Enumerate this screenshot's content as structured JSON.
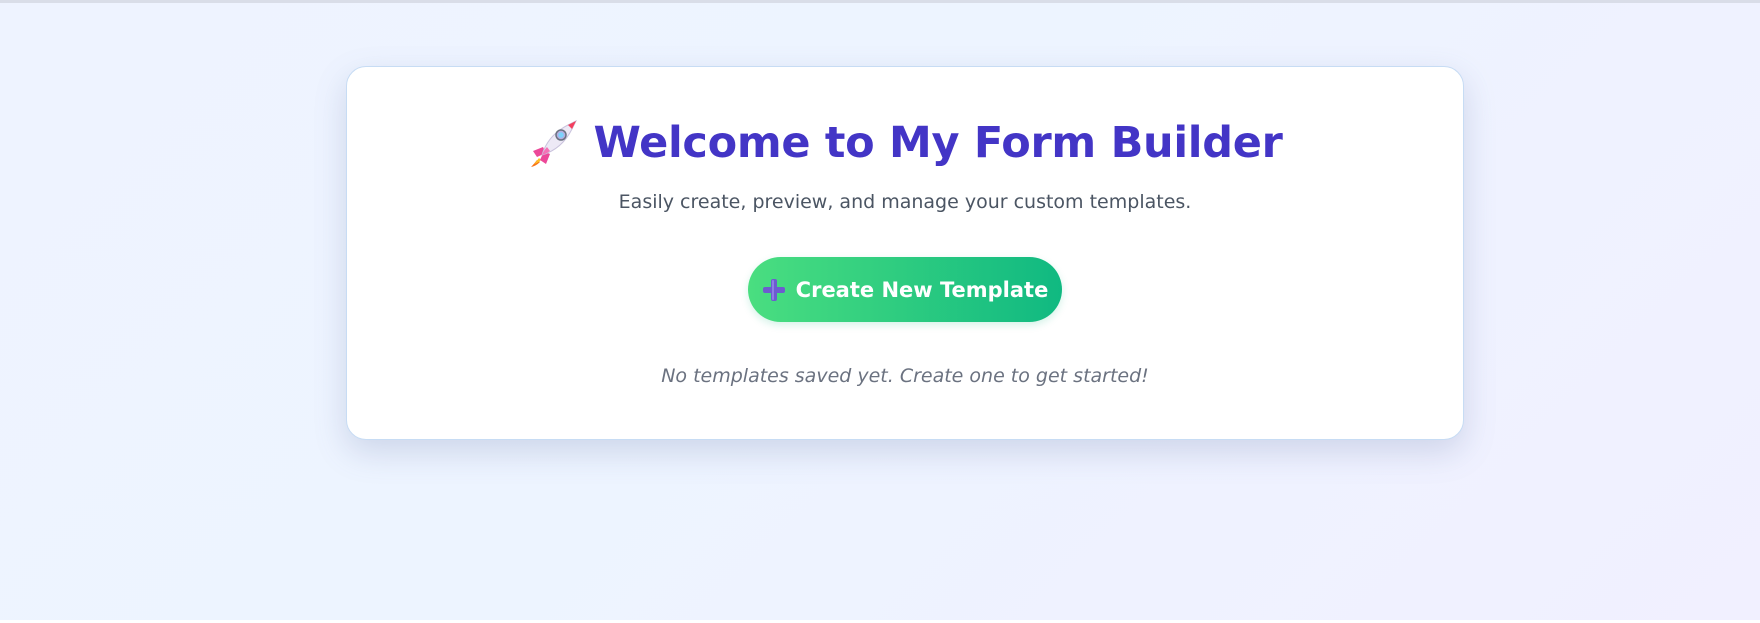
{
  "page": {
    "title": "Welcome to My Form Builder",
    "title_icon": "rocket-icon",
    "subtitle": "Easily create, preview, and manage your custom templates."
  },
  "actions": {
    "create_label": "Create New Template",
    "create_icon": "plus-icon"
  },
  "templates": {
    "items": [],
    "empty_message": "No templates saved yet. Create one to get started!"
  },
  "colors": {
    "title": "#4335c6",
    "button_gradient_start": "#4ade80",
    "button_gradient_end": "#10b981",
    "plus_icon": "#6d5bd0"
  }
}
